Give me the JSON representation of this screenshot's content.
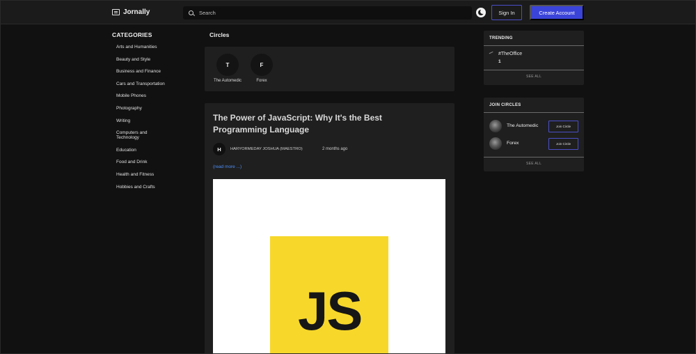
{
  "header": {
    "logo_text": "Jornally",
    "search_placeholder": "Search",
    "sign_in_label": "Sign In",
    "create_account_label": "Create Account"
  },
  "categories": {
    "title": "CATEGORIES",
    "items": [
      "Arts and Humanities",
      "Beauty and Style",
      "Business and Finance",
      "Cars and Transportation",
      "Mobile Phones",
      "Photography",
      "Writing",
      "Computers and Technology",
      "Education",
      "Food and Drink",
      "Health and Fitness",
      "Hobbies and Crafts"
    ]
  },
  "circles": {
    "title": "Circles",
    "items": [
      {
        "initial": "T",
        "name": "The Automedic"
      },
      {
        "initial": "F",
        "name": "Forex"
      }
    ]
  },
  "post": {
    "title": "The Power of JavaScript: Why It's the Best Programming Language",
    "author_initial": "H",
    "author": "HARYORMEDAY JOSHUA (MAESTRO)",
    "time": "2 months ago",
    "read_more": "(read more ...)",
    "image_text": "JS"
  },
  "trending": {
    "title": "TRENDING",
    "tag": "#TheOffice",
    "count": "1",
    "see_all": "SEE ALL"
  },
  "join_circles": {
    "title": "JOIN CIRCLES",
    "items": [
      {
        "name": "The Automedic",
        "button": "Join Circle"
      },
      {
        "name": "Forex",
        "button": "Join Circle"
      }
    ],
    "see_all": "SEE ALL"
  },
  "colors": {
    "accent": "#3b44d9",
    "link": "#4d8ff7",
    "background": "#111111",
    "card": "#1f1f1f",
    "js_yellow": "#f7d72a"
  }
}
